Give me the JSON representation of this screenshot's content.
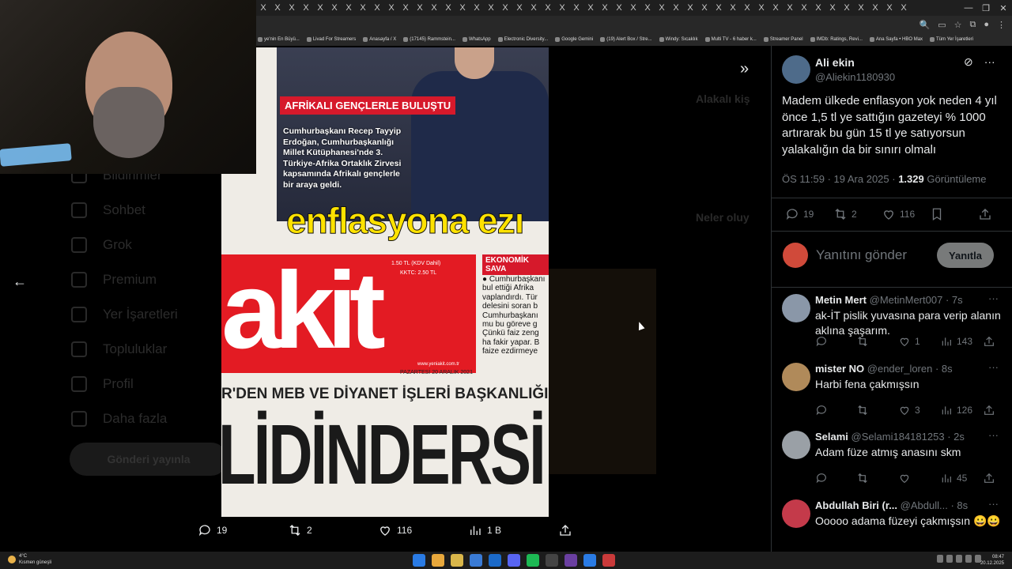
{
  "browser": {
    "tab_close_glyph": "X",
    "tab_count": 46,
    "window_controls": [
      "—",
      "❐",
      "✕"
    ],
    "bookmarks": [
      "ye'nin En Büyü...",
      "Livad For Streamers",
      "Anasayfa / X",
      "(17145) Rammstein...",
      "WhatsApp",
      "Electronic Diversity...",
      "Google Gemini",
      "(19) Alert Box / Stre...",
      "Windy: Sıcaklık",
      "Multi TV - 6 haber k...",
      "Streamer Panel",
      "IMDb: Ratings, Revi...",
      "Ana Sayfa • HBO Max",
      "Tüm Yer İşaretleri"
    ]
  },
  "background_nav": {
    "items": [
      "Bildirimler",
      "Sohbet",
      "Grok",
      "Premium",
      "Yer İşaretleri",
      "Topluluklar",
      "Profil",
      "Daha fazla"
    ],
    "post_button": "Gönderi yayınla",
    "right_heading_1": "Alakalı kiş",
    "right_heading_2": "Neler oluy"
  },
  "newspaper": {
    "banner": "AFRİKALI GENÇLERLE BULUŞTU",
    "caption": "Cumhurbaşkanı Recep Tayyip Erdoğan, Cumhurbaşkanlığı Millet Kütüphanesi'nde 3. Türkiye-Afrika Ortaklık Zirvesi kapsamında Afrikalı gençlerle bir araya geldi.",
    "headline_yellow": "enflasyona ezı",
    "logo": "akit",
    "price_1": "1.50 TL (KDV Dahil)",
    "price_2": "KKTC: 2.50 TL",
    "url": "www.yeniakit.com.tr",
    "date": "PAZARTESİ 20 ARALIK 2021",
    "economy_tag": "EKONOMİK SAVA",
    "economy_text": "● Cumhurbaşkanı bul ettiği Afrika vaplandırdı. Tür delesini soran b Cumhurbaşkanı mu bu göreve g Çünkü faiz zeng ha fakir yapar. B faize ezdirmeye",
    "strap": "R'DEN MEB VE DİYANET İŞLERİ BAŞKANLIĞI İLE VE",
    "big_text": "LİDİNDERSİ"
  },
  "media_bar": {
    "replies": "19",
    "reposts": "2",
    "likes": "116",
    "views": "1 B"
  },
  "tweet": {
    "author_name": "Ali ekin",
    "author_handle": "@Aliekin1180930",
    "text": "Madem ülkede enflasyon yok neden 4 yıl önce 1,5 tl ye sattığın gazeteyi % 1000 artırarak bu gün 15 tl ye satıyorsun yalakalığın da bir sınırı olmalı",
    "time": "ÖS 11:59 · 19 Ara 2025 · ",
    "views_count": "1.329",
    "views_label": " Görüntüleme",
    "replies": "19",
    "reposts": "2",
    "likes": "116"
  },
  "reply_box": {
    "placeholder": "Yanıtını gönder",
    "button": "Yanıtla"
  },
  "replies": [
    {
      "name": "Metin Mert",
      "handle": "@MetinMert007",
      "time": "· 7s",
      "text": "ak-İT pislik yuvasına para verip alanın aklına şaşarım.",
      "likes": "1",
      "views": "143",
      "avatar_color": "#8a97a8"
    },
    {
      "name": "mister NO",
      "handle": "@ender_loren",
      "time": "· 8s",
      "text": "Harbi fena çakmışsın",
      "likes": "3",
      "views": "126",
      "avatar_color": "#b08a5a"
    },
    {
      "name": "Selami",
      "handle": "@Selami184181253",
      "time": "· 2s",
      "text": "Adam füze atmış anasını skm",
      "likes": "",
      "views": "45",
      "avatar_color": "#9aa0a6"
    },
    {
      "name": "Abdullah Biri (r...",
      "handle": "@Abdull...",
      "time": "· 8s",
      "text": "Ooooo adama füzeyi çakmışsın 😀😀",
      "likes": "",
      "views": "",
      "avatar_color": "#c43a4a"
    }
  ],
  "taskbar": {
    "temp": "4°C",
    "weather": "Kısmen güneşli",
    "time": "08:47",
    "date": "20.12.2025"
  }
}
